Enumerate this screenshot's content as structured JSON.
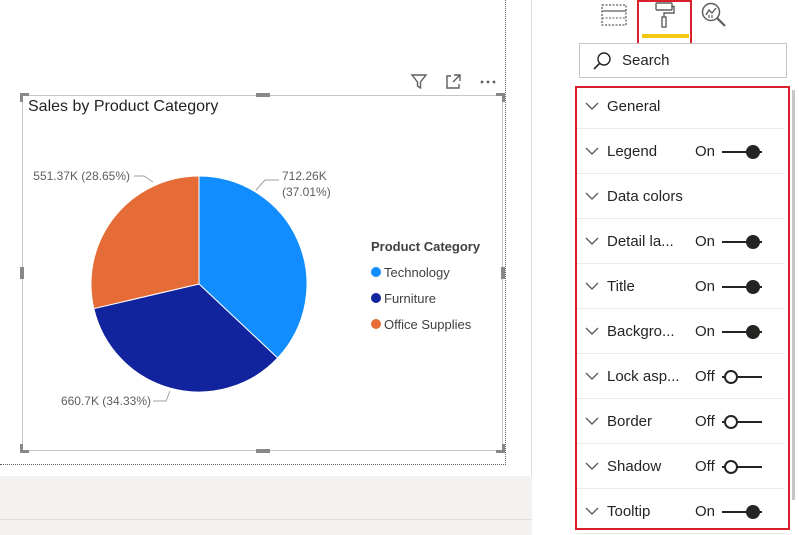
{
  "colors": {
    "technology": "#118dff",
    "furniture": "#12239e",
    "office_supplies": "#e66c37",
    "highlight": "#d9202a",
    "active_tab_underline": "#f2c811"
  },
  "visual_header_icons": [
    "filter-icon",
    "focus-mode-icon",
    "more-options-icon"
  ],
  "chart_data": {
    "type": "pie",
    "title": "Sales by Product Category",
    "legend_title": "Product Category",
    "legend_position": "right",
    "slices": [
      {
        "name": "Technology",
        "value": 712260,
        "label": "712.26K",
        "percent_label": "(37.01%)",
        "color": "#118dff"
      },
      {
        "name": "Furniture",
        "value": 660700,
        "label": "660.7K (34.33%)",
        "percent_label": "",
        "color": "#12239e"
      },
      {
        "name": "Office Supplies",
        "value": 551370,
        "label": "551.37K (28.65%)",
        "percent_label": "",
        "color": "#e66c37"
      }
    ]
  },
  "pane": {
    "tabs": [
      {
        "name": "fields-tab",
        "icon": "table-grid-icon"
      },
      {
        "name": "format-tab",
        "icon": "paint-roller-icon",
        "active": true
      },
      {
        "name": "analytics-tab",
        "icon": "analytics-magnifier-icon"
      }
    ],
    "search": {
      "placeholder": "Search"
    },
    "sections": [
      {
        "label": "General",
        "state": ""
      },
      {
        "label": "Legend",
        "state": "On"
      },
      {
        "label": "Data colors",
        "state": ""
      },
      {
        "label": "Detail la...",
        "state": "On"
      },
      {
        "label": "Title",
        "state": "On"
      },
      {
        "label": "Backgro...",
        "state": "On"
      },
      {
        "label": "Lock asp...",
        "state": "Off"
      },
      {
        "label": "Border",
        "state": "Off"
      },
      {
        "label": "Shadow",
        "state": "Off"
      },
      {
        "label": "Tooltip",
        "state": "On"
      }
    ]
  }
}
